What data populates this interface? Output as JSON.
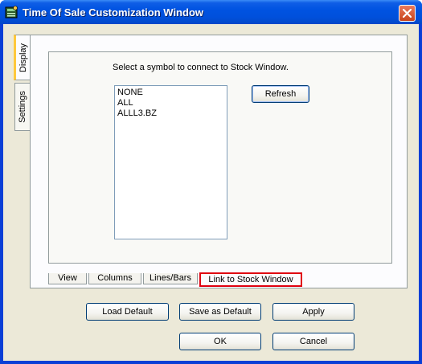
{
  "window": {
    "title": "Time Of Sale Customization Window"
  },
  "side_tabs": [
    {
      "label": "Display",
      "active": true
    },
    {
      "label": "Settings",
      "active": false
    }
  ],
  "link_panel": {
    "prompt": "Select a symbol to connect to Stock Window.",
    "symbols": [
      "NONE",
      "ALL",
      "ALLL3.BZ"
    ],
    "refresh_label": "Refresh"
  },
  "bottom_tabs": [
    {
      "label": "View",
      "active": false
    },
    {
      "label": "Columns",
      "active": false
    },
    {
      "label": "Lines/Bars",
      "active": false
    },
    {
      "label": "Link to Stock Window",
      "active": true
    }
  ],
  "buttons": {
    "load_default": "Load Default",
    "save_default": "Save as Default",
    "apply": "Apply",
    "ok": "OK",
    "cancel": "Cancel"
  },
  "colors": {
    "titlebar": "#0053e1",
    "dialog_bg": "#ece9d8",
    "active_tab_highlight": "#e0000f"
  }
}
